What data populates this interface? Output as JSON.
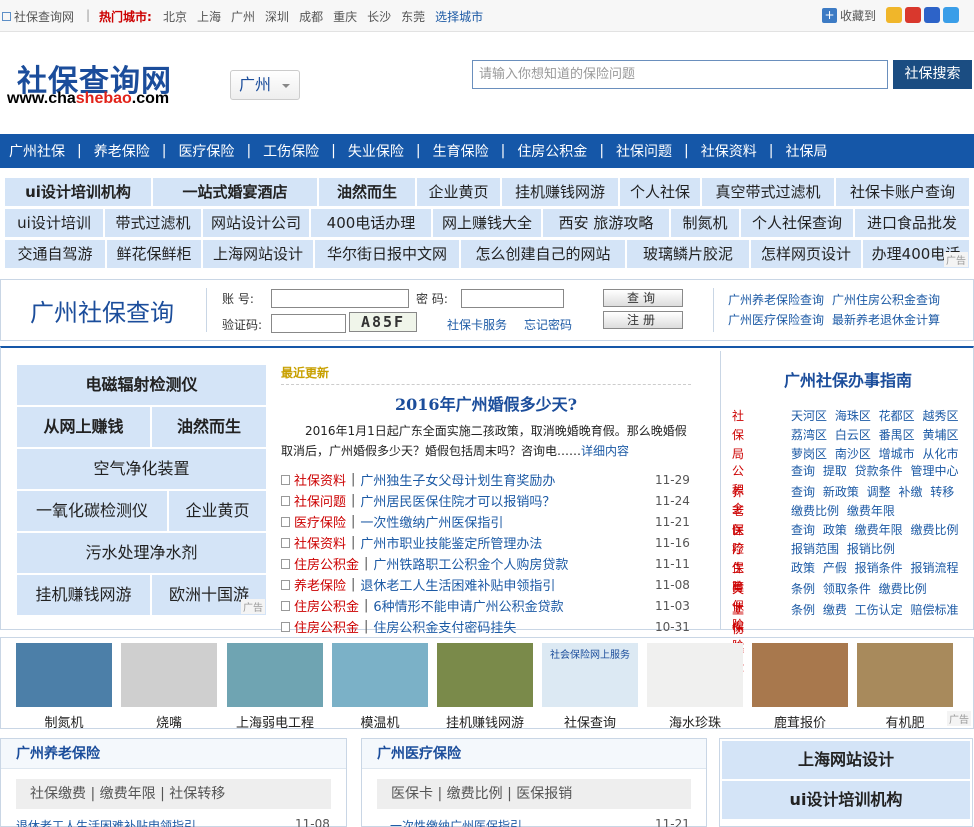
{
  "topbar": {
    "home": "社保查询网",
    "divider": "|",
    "hot_label": "热门城市:",
    "cities": [
      "北京",
      "上海",
      "广州",
      "深圳",
      "成都",
      "重庆",
      "长沙",
      "东莞"
    ],
    "choose": "选择城市",
    "fav": "收藏到"
  },
  "logo": {
    "title": "社保查询网",
    "url_pre": "www.cha",
    "url_mid": "shebao",
    "url_post": ".com"
  },
  "city_select": "广州",
  "search": {
    "placeholder": "请输入你想知道的保险问题",
    "button": "社保搜索"
  },
  "nav": [
    "广州社保",
    "养老保险",
    "医疗保险",
    "工伤保险",
    "失业保险",
    "生育保险",
    "住房公积金",
    "社保问题",
    "社保资料",
    "社保局"
  ],
  "ads": [
    [
      "ui设计培训机构",
      "一站式婚宴酒店",
      "油然而生",
      "企业黄页",
      "挂机赚钱网游",
      "个人社保",
      "真空带式过滤机",
      "社保卡账户查询"
    ],
    [
      "ui设计培训",
      "带式过滤机",
      "网站设计公司",
      "400电话办理",
      "网上赚钱大全",
      "西安 旅游攻略",
      "制氮机",
      "个人社保查询",
      "进口食品批发"
    ],
    [
      "交通自驾游",
      "鲜花保鲜柜",
      "上海网站设计",
      "华尔街日报中文网",
      "怎么创建自己的网站",
      "玻璃鳞片胶泥",
      "怎样网页设计",
      "办理400电话"
    ]
  ],
  "ad_tag": "广告",
  "login": {
    "title": "广州社保查询",
    "account": "账  号:",
    "password": "密  码:",
    "captcha_label": "验证码:",
    "captcha": "A85F",
    "card_service": "社保卡服务",
    "forgot": "忘记密码",
    "query_btn": "查询",
    "register_btn": "注册",
    "links": [
      "广州养老保险查询",
      "广州住房公积金查询",
      "广州医疗保险查询",
      "最新养老退休金计算"
    ]
  },
  "left_ads": [
    [
      "电磁辐射检测仪"
    ],
    [
      "从网上赚钱",
      "油然而生"
    ],
    [
      "空气净化装置"
    ],
    [
      "一氧化碳检测仪",
      "企业黄页"
    ],
    [
      "污水处理净水剂"
    ],
    [
      "挂机赚钱网游",
      "欧洲十国游"
    ]
  ],
  "news": {
    "header": "最近更新",
    "headline": "2016年广州婚假多少天?",
    "summary": "2016年1月1日起广东全面实施二孩政策，取消晚婚晚育假。那么晚婚假取消后，广州婚假多少天？婚假包括周末吗？咨询电……",
    "more": "详细内容",
    "items": [
      {
        "cat": "社保资料",
        "title": "广州独生子女父母计划生育奖励办",
        "date": "11-29"
      },
      {
        "cat": "社保问题",
        "title": "广州居民医保住院才可以报销吗？",
        "date": "11-24"
      },
      {
        "cat": "医疗保险",
        "title": "一次性缴纳广州医保指引",
        "date": "11-21"
      },
      {
        "cat": "社保资料",
        "title": "广州市职业技能鉴定所管理办法",
        "date": "11-16"
      },
      {
        "cat": "住房公积金",
        "title": "广州铁路职工公积金个人购房贷款",
        "date": "11-11"
      },
      {
        "cat": "养老保险",
        "title": "退休老工人生活困难补贴申领指引",
        "date": "11-08"
      },
      {
        "cat": "住房公积金",
        "title": "6种情形不能申请广州公积金贷款",
        "date": "11-03"
      },
      {
        "cat": "住房公积金",
        "title": "住房公积金支付密码挂失",
        "date": "10-31"
      }
    ]
  },
  "guide": {
    "title": "广州社保办事指南",
    "rows": [
      {
        "k": "社保局",
        "v": "天河区 海珠区 花都区 越秀区 荔湾区 白云区 番禺区 黄埔区 萝岗区 南沙区 增城市 从化市"
      },
      {
        "k": "公积金",
        "v": "查询 提取 贷款条件 管理中心"
      },
      {
        "k": "养老保险",
        "v": "查询 新政策 调整 补缴 转移 缴费比例 缴费年限"
      },
      {
        "k": "医疗保险",
        "v": "查询 政策 缴费年限 缴费比例 报销范围 报销比例"
      },
      {
        "k": "生育保险",
        "v": "政策 产假 报销条件 报销流程"
      },
      {
        "k": "失业保险",
        "v": "条例 领取条件 缴费比例"
      },
      {
        "k": "工伤保险",
        "v": "条例 缴费 工伤认定 赔偿标准"
      }
    ]
  },
  "pics": [
    {
      "cap": "制氮机",
      "color": "#4c7fa8"
    },
    {
      "cap": "烧嘴",
      "color": "#cfcfcf"
    },
    {
      "cap": "上海弱电工程",
      "color": "#6fa4b2"
    },
    {
      "cap": "模温机",
      "color": "#7bb1c7"
    },
    {
      "cap": "挂机赚钱网游",
      "color": "#7a8a4a"
    },
    {
      "cap": "社保查询",
      "color": "#dce9f3"
    },
    {
      "cap": "海水珍珠",
      "color": "#f0f0ef"
    },
    {
      "cap": "鹿茸报价",
      "color": "#a8784d"
    },
    {
      "cap": "有机肥",
      "color": "#a88a5c"
    }
  ],
  "pic_screen_title": "社会保险网上服务",
  "box1": {
    "title": "广州养老保险",
    "sub": "社保缴费 | 缴费年限 | 社保转移",
    "frag": "退休老工人生活困难补贴申领指引",
    "date": "11-08"
  },
  "box2": {
    "title": "广州医疗保险",
    "sub": "医保卡 | 缴费比例 | 医保报销",
    "frag": "一次性缴纳广州医保指引",
    "date": "11-21"
  },
  "right_box": [
    "上海网站设计",
    "ui设计培训机构"
  ]
}
